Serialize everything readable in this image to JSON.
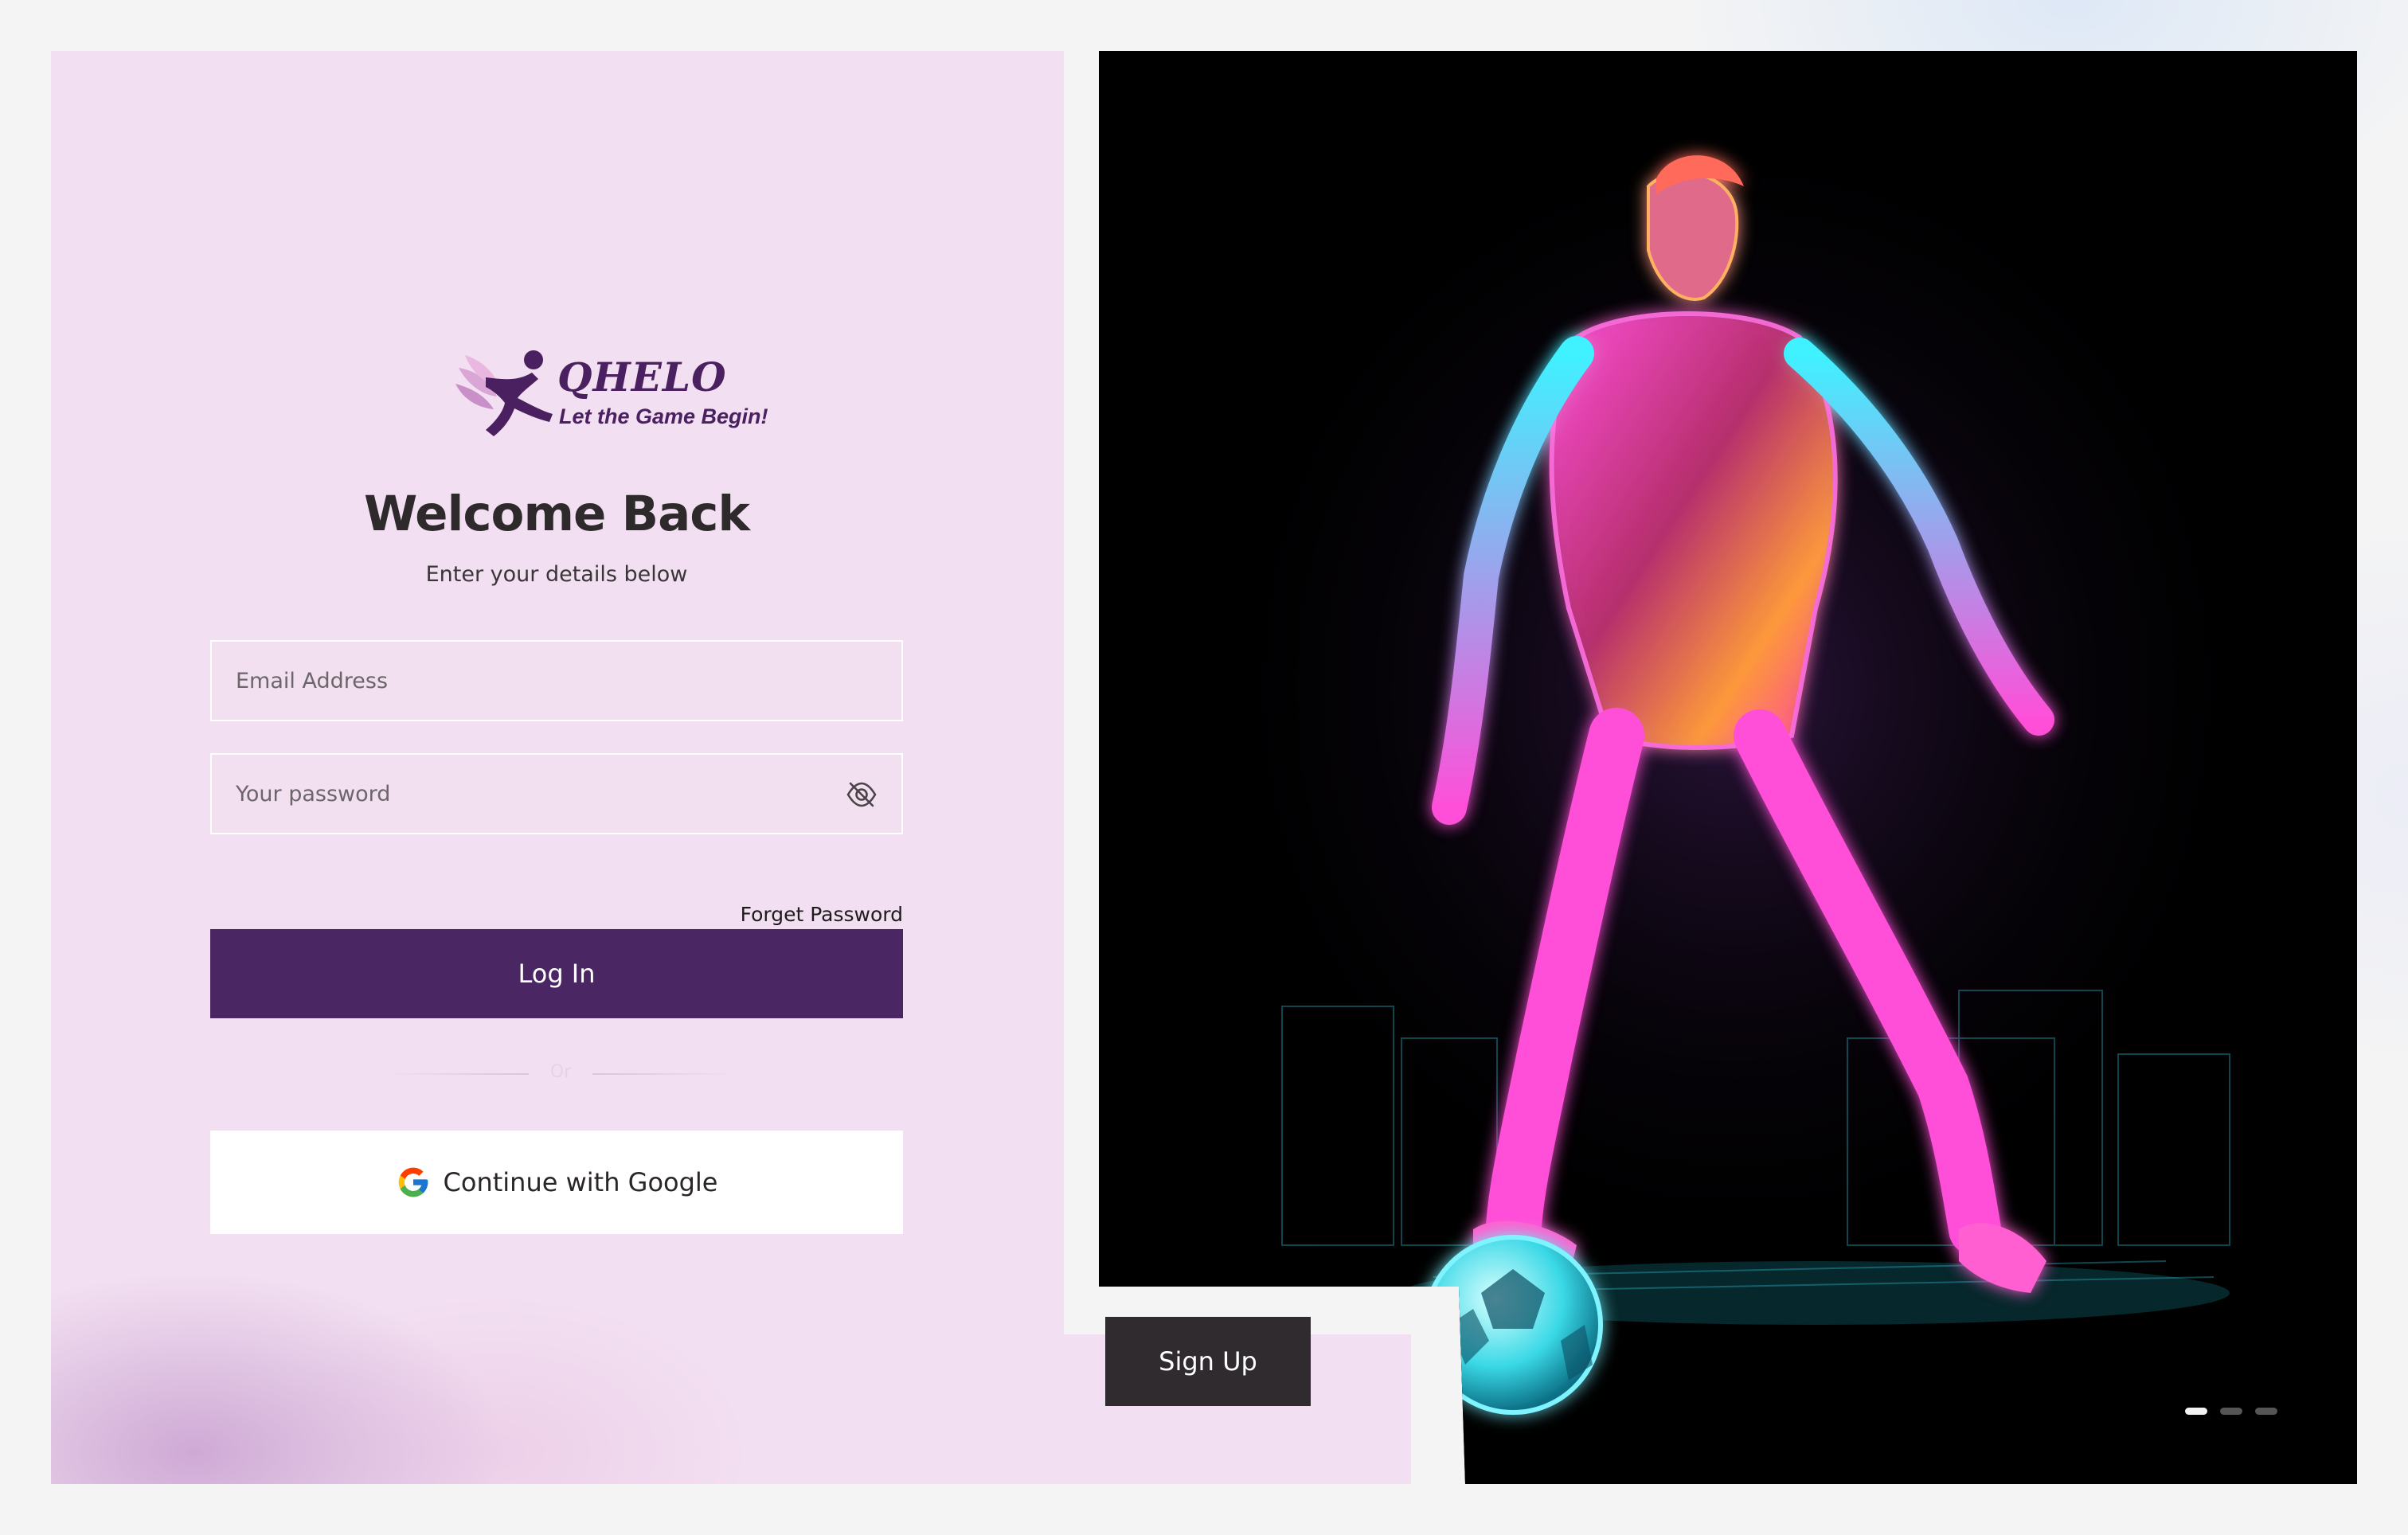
{
  "brand": {
    "name": "QHELO",
    "tagline": "Let the Game Begin!"
  },
  "login": {
    "title": "Welcome Back",
    "subtitle": "Enter your details below",
    "email_placeholder": "Email Address",
    "password_placeholder": "Your password",
    "forgot_label": "Forget Password",
    "login_label": "Log In",
    "divider_label": "Or",
    "google_label": "Continue with Google"
  },
  "signup": {
    "label": "Sign Up"
  },
  "carousel": {
    "slides": 3,
    "active": 1
  },
  "colors": {
    "primary": "#4a2763",
    "panel_bg": "#f2dff1",
    "dark_button": "#2f2b2e"
  },
  "icons": {
    "logo": "running-figure-logo-icon",
    "password_toggle": "eye-slash-icon",
    "google": "google-g-icon"
  }
}
